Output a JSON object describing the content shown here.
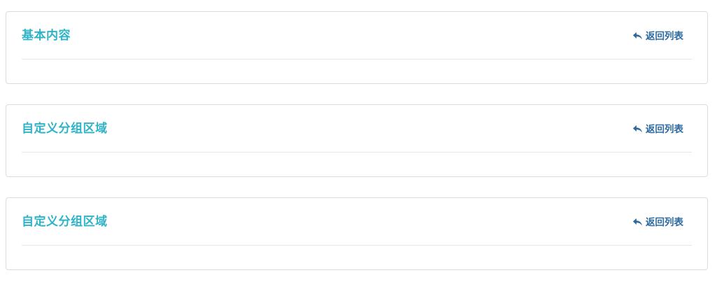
{
  "panels": [
    {
      "title": "基本内容",
      "back_label": "返回列表",
      "back_icon": "reply-arrow-icon"
    },
    {
      "title": "自定义分组区域",
      "back_label": "返回列表",
      "back_icon": "reply-arrow-icon"
    },
    {
      "title": "自定义分组区域",
      "back_label": "返回列表",
      "back_icon": "reply-arrow-icon"
    }
  ],
  "colors": {
    "title": "#2fb3c6",
    "link": "#2d6a9f",
    "border": "#dcdcdc",
    "divider": "#e6e6e6"
  }
}
